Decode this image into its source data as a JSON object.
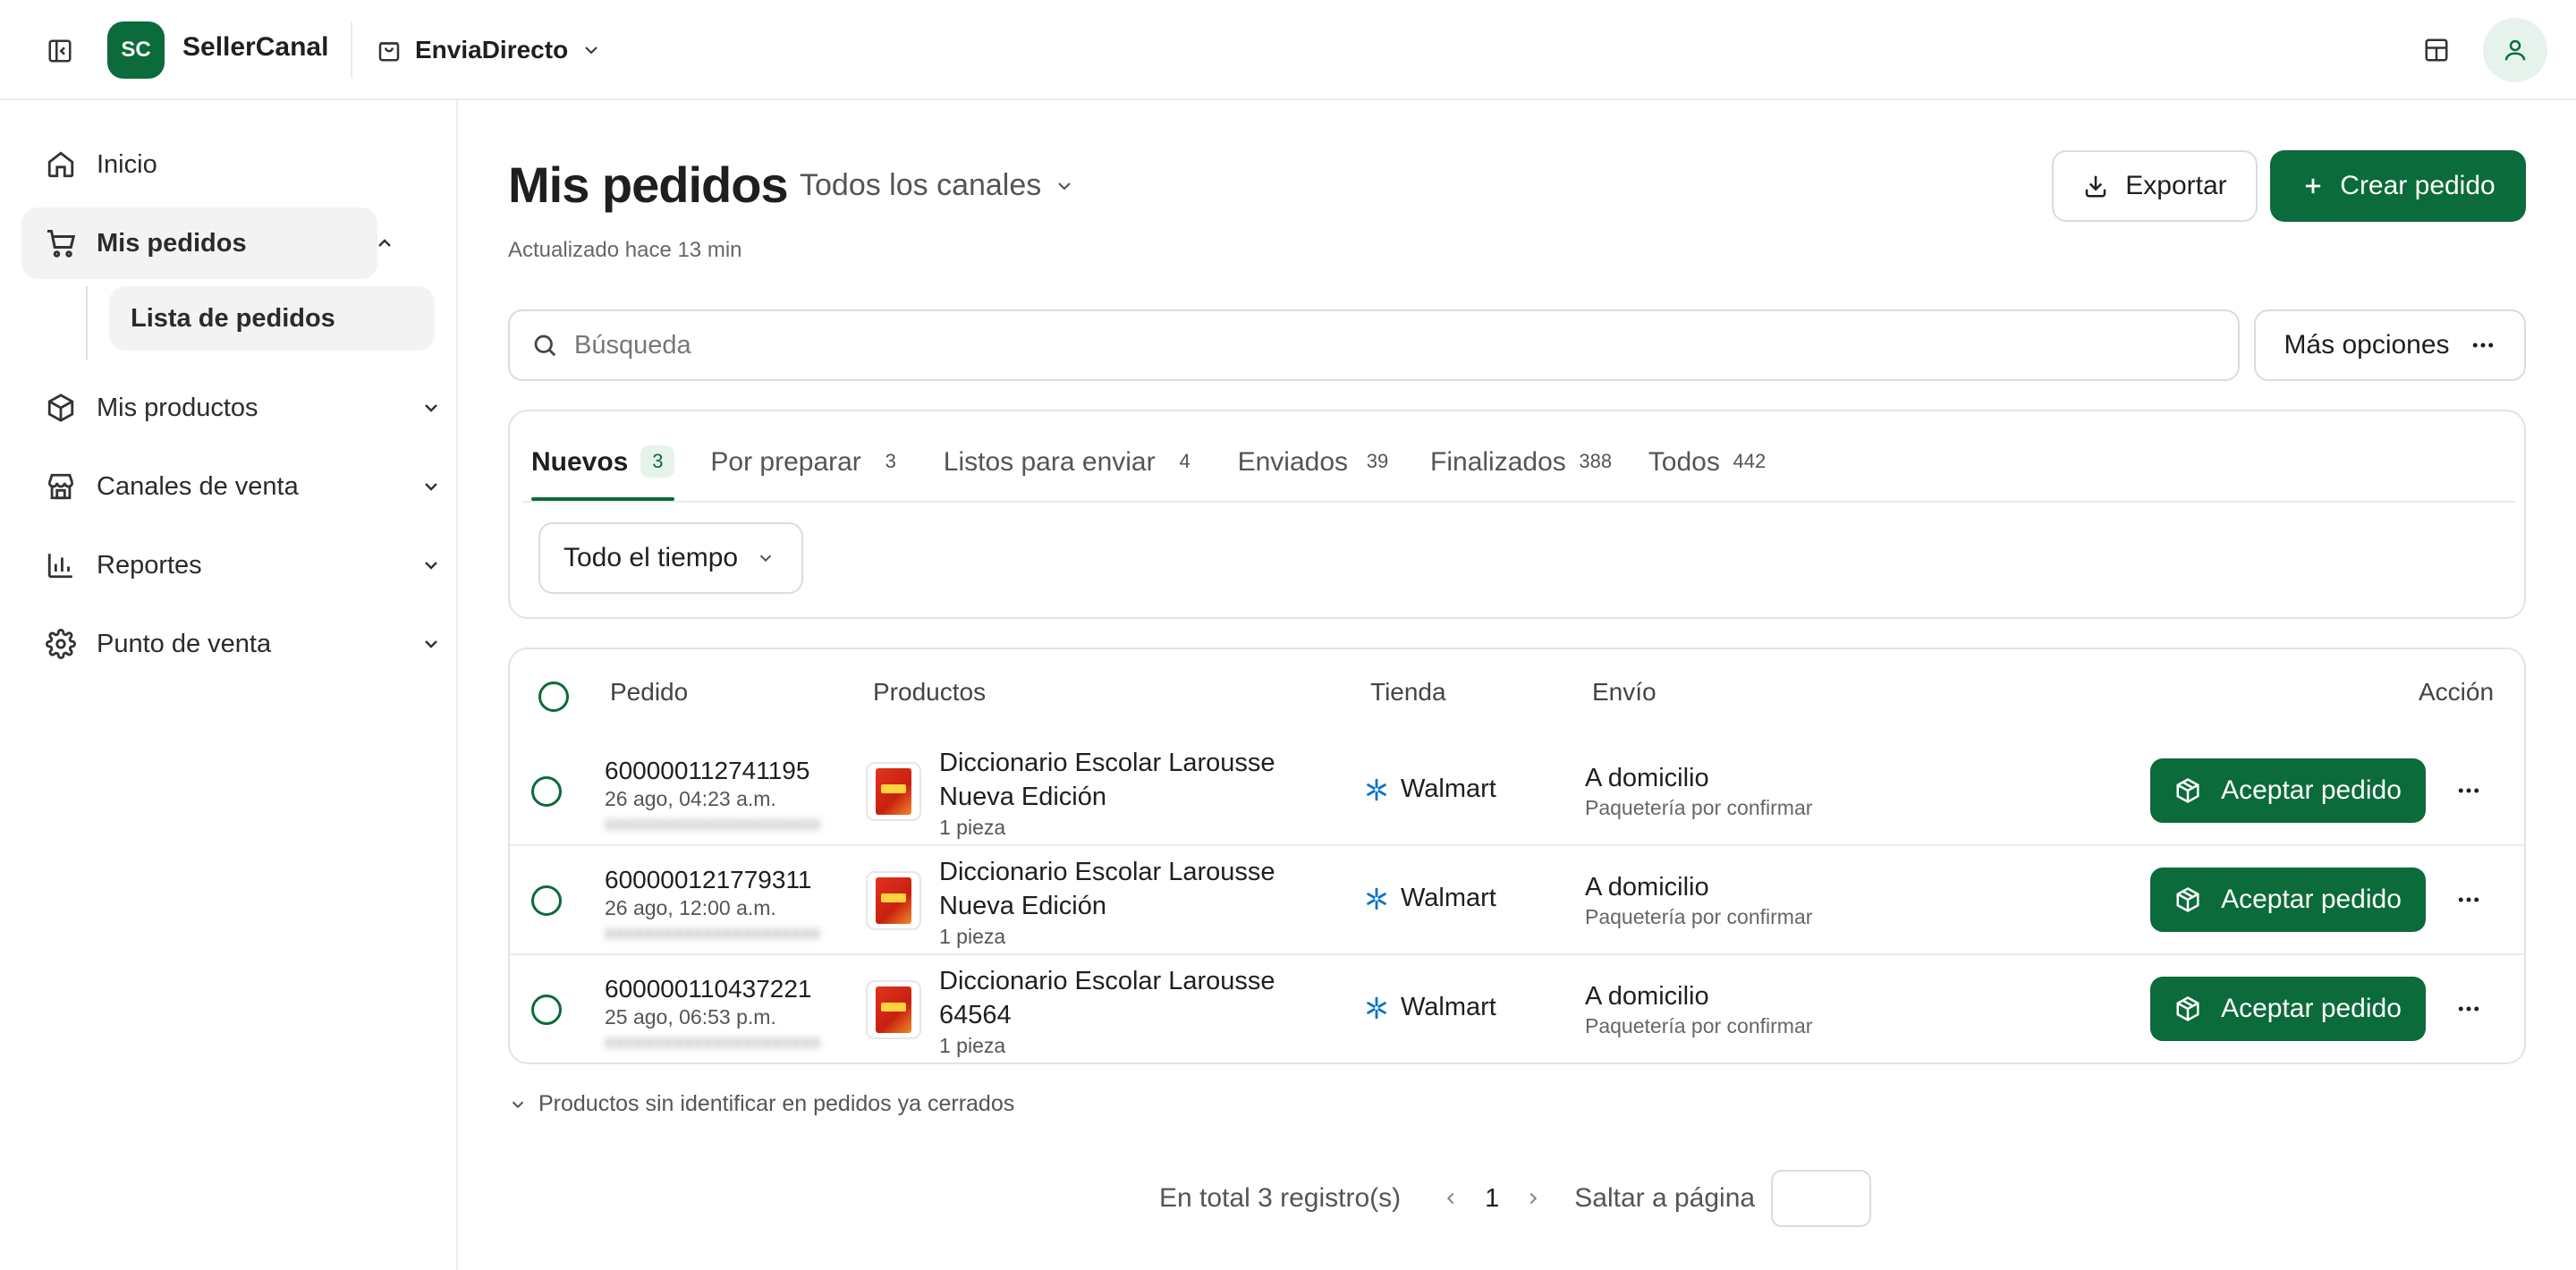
{
  "colors": {
    "brand": "#0b6b3a",
    "brand_soft": "#e5f3ea",
    "border": "#e3e3e3"
  },
  "topbar": {
    "logo_text": "SC",
    "brand": "SellerCanal",
    "store": "EnviaDirecto",
    "icons": [
      "sidebar-toggle-icon",
      "shopping-bag-icon",
      "chevron-down-icon",
      "layout-grid-icon",
      "user-icon"
    ]
  },
  "sidebar": {
    "items": [
      {
        "label": "Inicio",
        "icon": "home-icon"
      },
      {
        "label": "Mis pedidos",
        "icon": "cart-icon",
        "expanded": true
      },
      {
        "label": "Mis productos",
        "icon": "box-icon"
      },
      {
        "label": "Canales de venta",
        "icon": "store-icon"
      },
      {
        "label": "Reportes",
        "icon": "bar-chart-icon"
      },
      {
        "label": "Punto de venta",
        "icon": "gear-icon"
      }
    ],
    "sub_items": [
      {
        "label": "Lista de pedidos"
      }
    ]
  },
  "header": {
    "title": "Mis pedidos",
    "channel_select": "Todos los canales",
    "updated": "Actualizado hace 13 min",
    "export_label": "Exportar",
    "create_label": "Crear pedido"
  },
  "search": {
    "placeholder": "Búsqueda",
    "value": ""
  },
  "more_options": "Más opciones",
  "tabs": [
    {
      "label": "Nuevos",
      "count": "3",
      "active": true
    },
    {
      "label": "Por preparar",
      "count": "3"
    },
    {
      "label": "Listos para enviar",
      "count": "4"
    },
    {
      "label": "Enviados",
      "count": "39"
    },
    {
      "label": "Finalizados",
      "count": "388"
    },
    {
      "label": "Todos",
      "count": "442"
    }
  ],
  "time_filter": "Todo el tiempo",
  "table": {
    "columns": [
      "Pedido",
      "Productos",
      "Tienda",
      "Envío",
      "Acción"
    ],
    "rows": [
      {
        "order_id": "600000112741195",
        "date": "26 ago, 04:23 a.m.",
        "product": "Diccionario Escolar Larousse Nueva Edición",
        "qty": "1 pieza",
        "store": "Walmart",
        "shipping": "A domicilio",
        "shipping_sub": "Paquetería por confirmar",
        "action": "Aceptar pedido"
      },
      {
        "order_id": "600000121779311",
        "date": "26 ago, 12:00 a.m.",
        "product": "Diccionario Escolar Larousse Nueva Edición",
        "qty": "1 pieza",
        "store": "Walmart",
        "shipping": "A domicilio",
        "shipping_sub": "Paquetería por confirmar",
        "action": "Aceptar pedido"
      },
      {
        "order_id": "600000110437221",
        "date": "25 ago, 06:53 p.m.",
        "product": "Diccionario Escolar Larousse 64564",
        "qty": "1 pieza",
        "store": "Walmart",
        "shipping": "A domicilio",
        "shipping_sub": "Paquetería por confirmar",
        "action": "Aceptar pedido"
      }
    ]
  },
  "unidentified_link": "Productos sin identificar en pedidos ya cerrados",
  "pagination": {
    "total": "En total 3 registro(s)",
    "current_page": "1",
    "jump_label": "Saltar a página",
    "jump_value": ""
  }
}
